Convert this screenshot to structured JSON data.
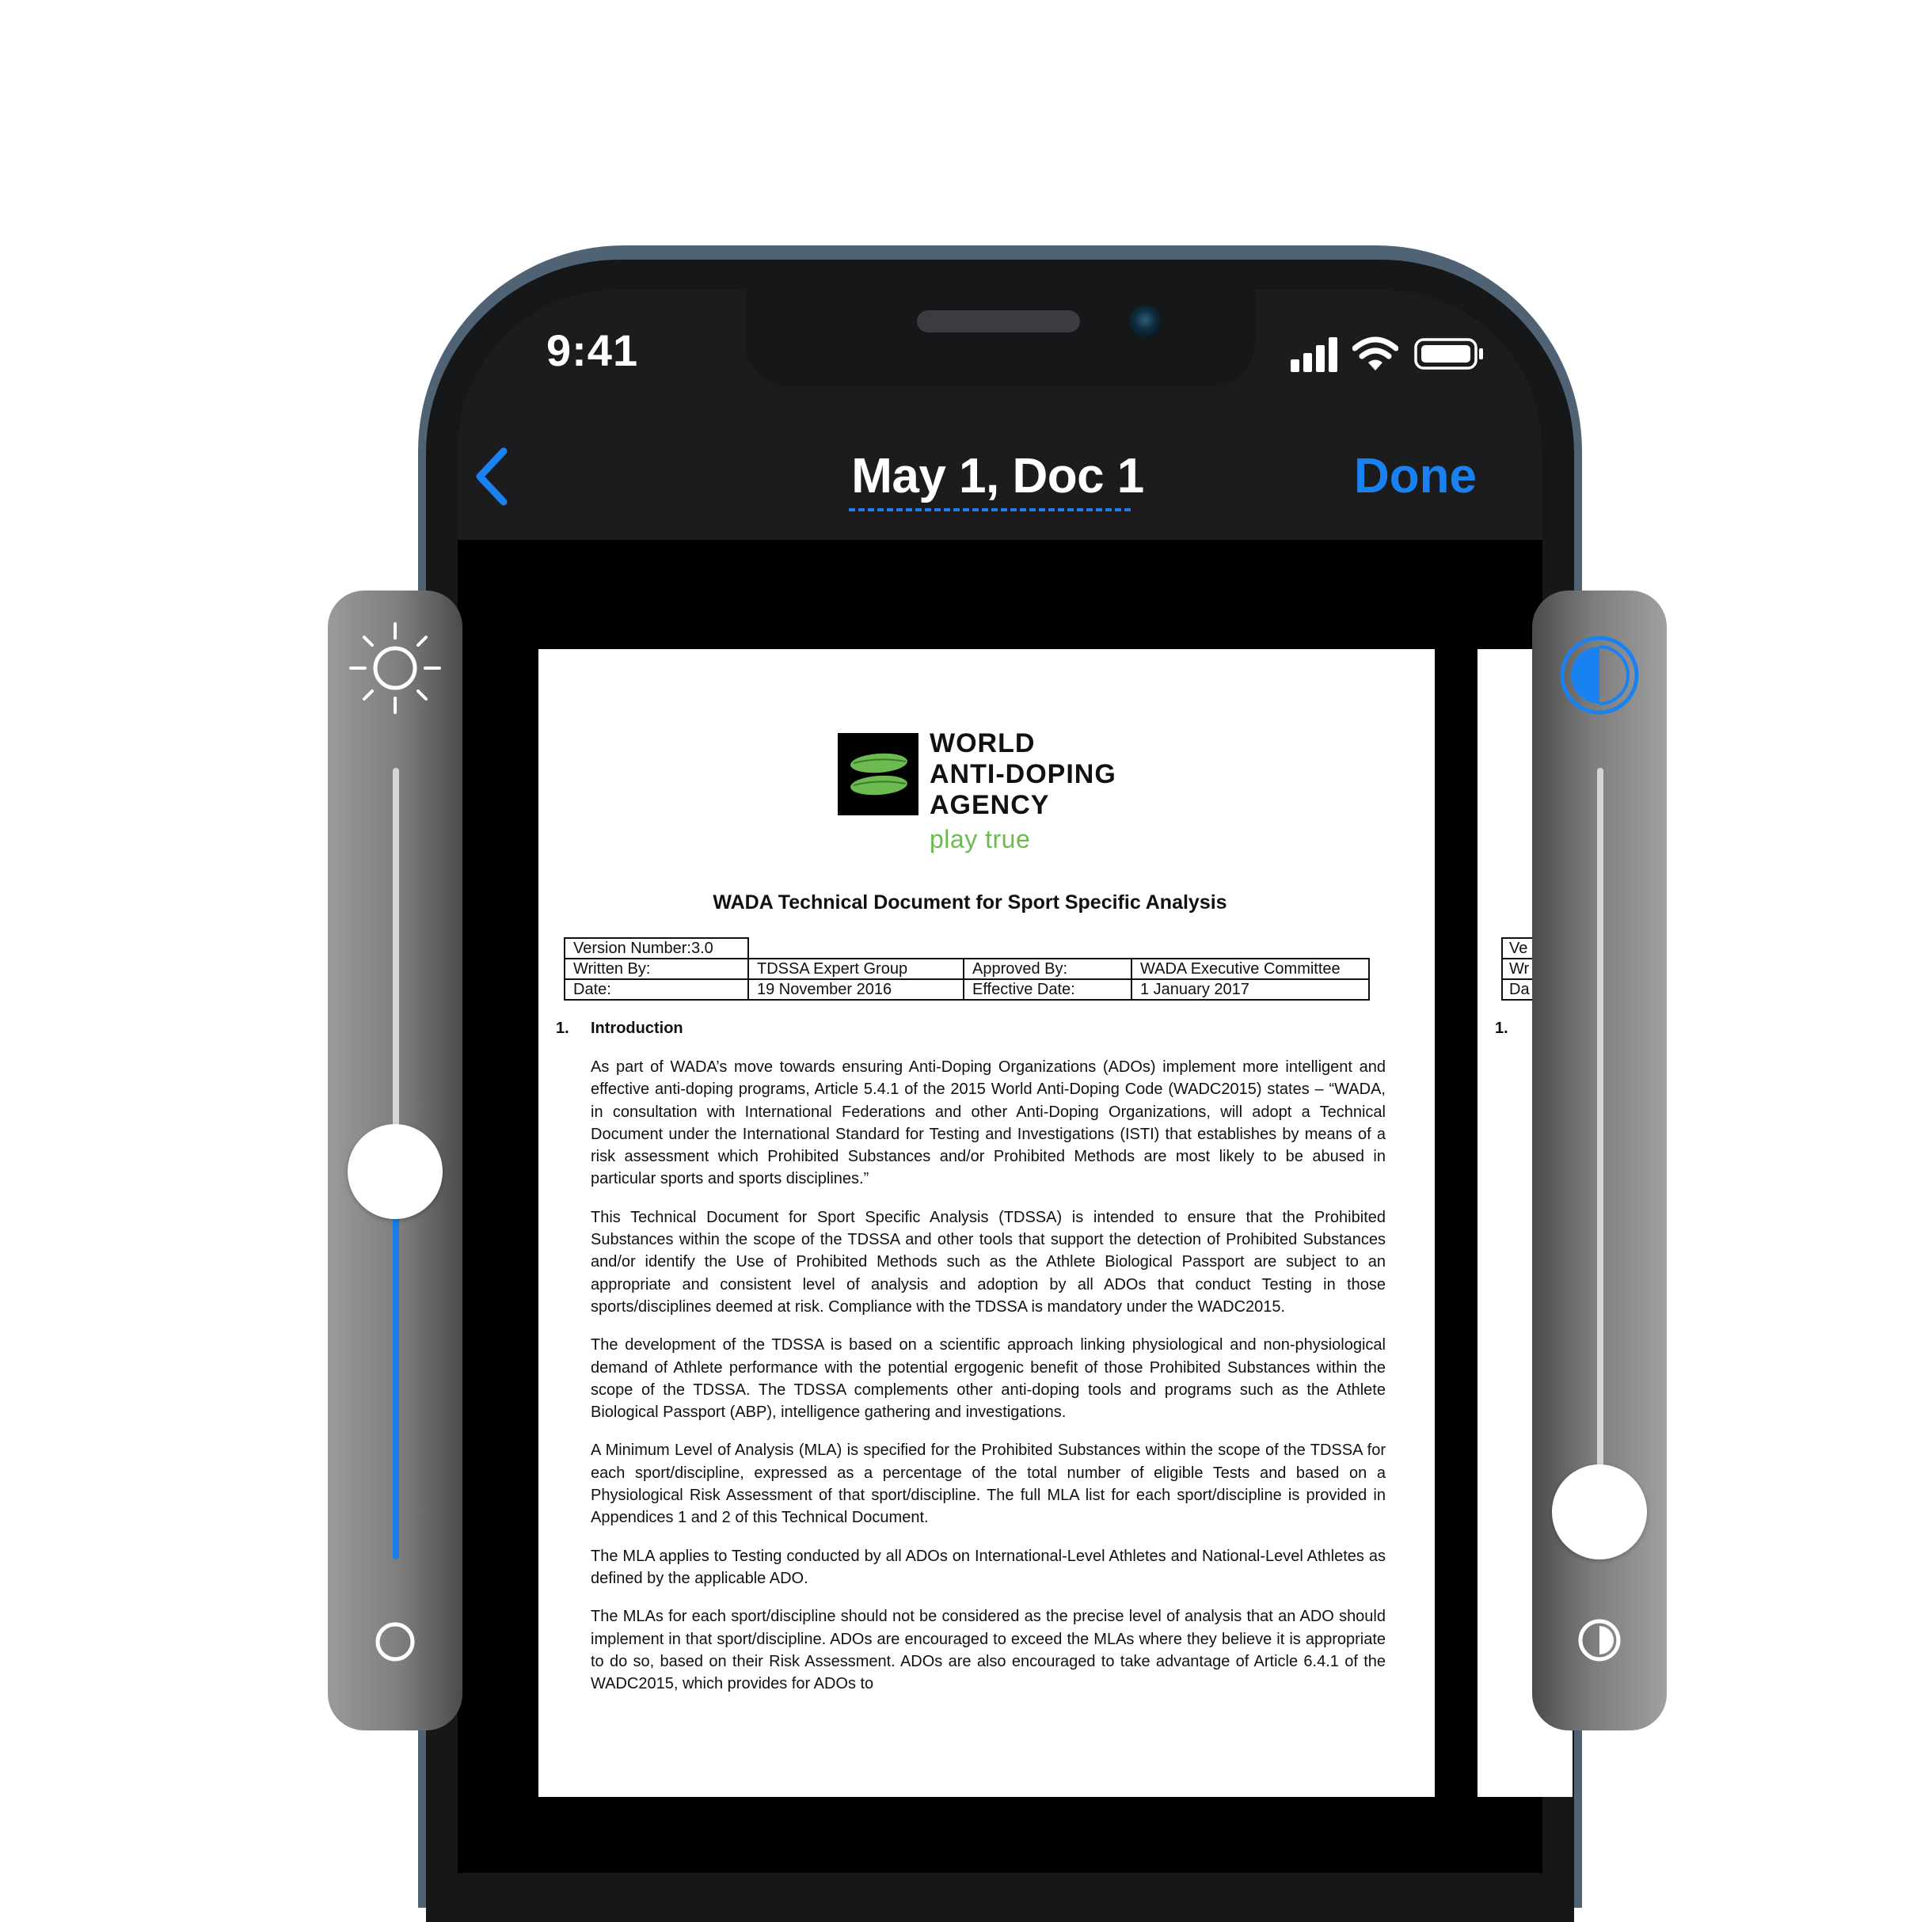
{
  "status_bar": {
    "time": "9:41"
  },
  "nav": {
    "title": "May 1, Doc 1",
    "done_label": "Done"
  },
  "colors": {
    "accent": "#1a82f0",
    "brand_green": "#6dbb50"
  },
  "document": {
    "org_name_lines": [
      "WORLD",
      "ANTI-DOPING",
      "AGENCY"
    ],
    "tagline": "play true",
    "title": "WADA Technical Document for Sport Specific Analysis",
    "meta": {
      "version": "Version Number:3.0",
      "written_by_label": "Written By:",
      "written_by": "TDSSA Expert Group",
      "approved_by_label": "Approved By:",
      "approved_by": "WADA Executive Committee",
      "date_label": "Date:",
      "date": "19 November 2016",
      "effective_label": "Effective Date:",
      "effective": "1 January 2017"
    },
    "section": {
      "number": "1.",
      "title": "Introduction"
    },
    "paragraphs": [
      "As part of WADA’s move towards ensuring Anti-Doping Organizations (ADOs) implement more intelligent and effective anti-doping programs, Article 5.4.1 of the 2015 World Anti-Doping Code (WADC2015) states – “WADA, in consultation with International Federations and other Anti-Doping Organizations, will adopt a Technical Document under the International Standard for Testing and Investigations (ISTI) that establishes by means of a risk assessment which Prohibited Substances and/or Prohibited Methods are most likely to be abused in particular sports and sports disciplines.”",
      "This Technical Document for Sport Specific Analysis (TDSSA) is intended to ensure that the Prohibited Substances within the scope of the TDSSA and other tools that support the detection of Prohibited Substances and/or identify the Use of Prohibited Methods such as the Athlete Biological Passport are subject to an appropriate and consistent level of analysis and adoption by all ADOs that conduct Testing in those sports/disciplines deemed at risk. Compliance with the TDSSA is mandatory under the WADC2015.",
      "The development of the TDSSA is based on a scientific approach linking physiological and non-physiological demand of Athlete performance with the potential ergogenic benefit of those Prohibited Substances within the scope of the TDSSA. The TDSSA complements other anti-doping tools and programs such as the Athlete Biological Passport (ABP), intelligence gathering and investigations.",
      "A Minimum Level of Analysis (MLA) is specified for the Prohibited Substances within the scope of the TDSSA for each sport/discipline, expressed as a percentage of the total number of eligible Tests and based on a Physiological Risk Assessment of that sport/discipline. The full MLA list for each sport/discipline is provided in Appendices 1 and 2 of this Technical Document.",
      "The MLA applies to Testing conducted by all ADOs on International-Level Athletes and National-Level Athletes as defined by the applicable ADO.",
      "The MLAs for each sport/discipline should not be considered as the precise level of analysis that an ADO should implement in that sport/discipline. ADOs are encouraged to exceed the MLAs where they believe it is appropriate to do so, based on their Risk Assessment.  ADOs are also encouraged to take advantage of Article 6.4.1 of the WADC2015, which provides for ADOs to"
    ],
    "next_page": {
      "meta_fragments": [
        "Ve",
        "Wr",
        "Da"
      ],
      "section_number": "1."
    }
  },
  "brightness_slider": {
    "value": 0.49
  },
  "contrast_slider": {
    "value": 0.06
  }
}
